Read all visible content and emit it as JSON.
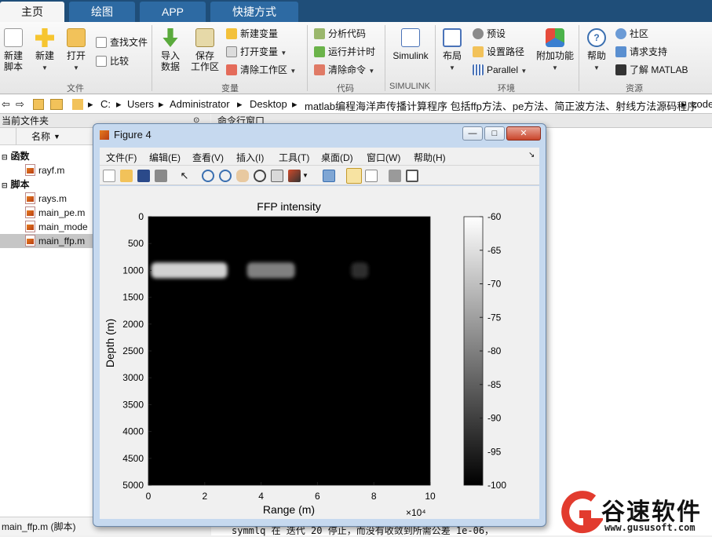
{
  "tabs": [
    {
      "label": "主页",
      "active": true
    },
    {
      "label": "绘图",
      "active": false
    },
    {
      "label": "APP",
      "active": false
    },
    {
      "label": "快捷方式",
      "active": false
    }
  ],
  "ribbon": {
    "file": {
      "group_label": "文件",
      "new_script": "新建\n脚本",
      "new": "新建",
      "open": "打开",
      "find_files": "查找文件",
      "compare": "比较"
    },
    "variable": {
      "group_label": "变量",
      "import": "导入\n数据",
      "save_workspace": "保存\n工作区",
      "new_variable": "新建变量",
      "open_variable": "打开变量",
      "clear_workspace": "清除工作区"
    },
    "code": {
      "group_label": "代码",
      "analyze": "分析代码",
      "run_time": "运行并计时",
      "clear_commands": "清除命令"
    },
    "simulink": {
      "group_label": "SIMULINK",
      "simulink": "Simulink"
    },
    "environment": {
      "group_label": "环境",
      "layout": "布局",
      "preferences": "预设",
      "set_path": "设置路径",
      "parallel": "Parallel",
      "addons": "附加功能"
    },
    "resources": {
      "group_label": "资源",
      "help": "帮助",
      "community": "社区",
      "request_support": "请求支持",
      "learn_matlab": "了解 MATLAB"
    }
  },
  "address": {
    "crumbs": [
      "C:",
      "Users",
      "Administrator",
      "Desktop",
      "matlab编程海洋声传播计算程序 包括ffp方法、pe方法、简正波方法、射线方法源码程序",
      "code"
    ]
  },
  "file_browser": {
    "title": "当前文件夹",
    "column_name": "名称",
    "groups": [
      {
        "label": "函数",
        "files": [
          "rayf.m"
        ]
      },
      {
        "label": "脚本",
        "files": [
          "rays.m",
          "main_pe.m",
          "main_mode",
          "main_ffp.m"
        ]
      }
    ],
    "selected": "main_ffp.m",
    "status": "main_ffp.m  (脚本)"
  },
  "command_window": {
    "title": "命令行窗口",
    "last_line": "symmlq 在 迭代 20 停止，而没有收敛到所需公差 1e-06，"
  },
  "figure": {
    "window_title": "Figure 4",
    "menu": [
      "文件(F)",
      "编辑(E)",
      "查看(V)",
      "插入(I)",
      "工具(T)",
      "桌面(D)",
      "窗口(W)",
      "帮助(H)"
    ],
    "window_buttons": {
      "minimize": "—",
      "maximize": "□",
      "close": "✕"
    }
  },
  "chart_data": {
    "type": "heatmap",
    "title": "FFP intensity",
    "xlabel": "Range (m)",
    "ylabel": "Depth (m)",
    "x_exponent_label": "×10⁴",
    "xlim": [
      0,
      10
    ],
    "ylim": [
      0,
      5000
    ],
    "y_reversed": true,
    "x_ticks": [
      0,
      2,
      4,
      6,
      8,
      10
    ],
    "y_ticks": [
      0,
      500,
      1000,
      1500,
      2000,
      2500,
      3000,
      3500,
      4000,
      4500,
      5000
    ],
    "colorbar": {
      "min": -100,
      "max": -60,
      "ticks": [
        -60,
        -65,
        -70,
        -75,
        -80,
        -85,
        -90,
        -95,
        -100
      ],
      "colormap": "gray"
    },
    "grid": false,
    "intensity_bands": [
      {
        "x_start": 0.1,
        "x_end": 2.8,
        "depth": 1000,
        "level": -67
      },
      {
        "x_start": 3.5,
        "x_end": 5.2,
        "depth": 1000,
        "level": -80
      },
      {
        "x_start": 7.2,
        "x_end": 7.8,
        "depth": 1000,
        "level": -93
      }
    ],
    "background_level": -100
  },
  "watermark": {
    "brand": "谷速软件",
    "url": "www.gususoft.com",
    "color": "#e23b2e"
  }
}
